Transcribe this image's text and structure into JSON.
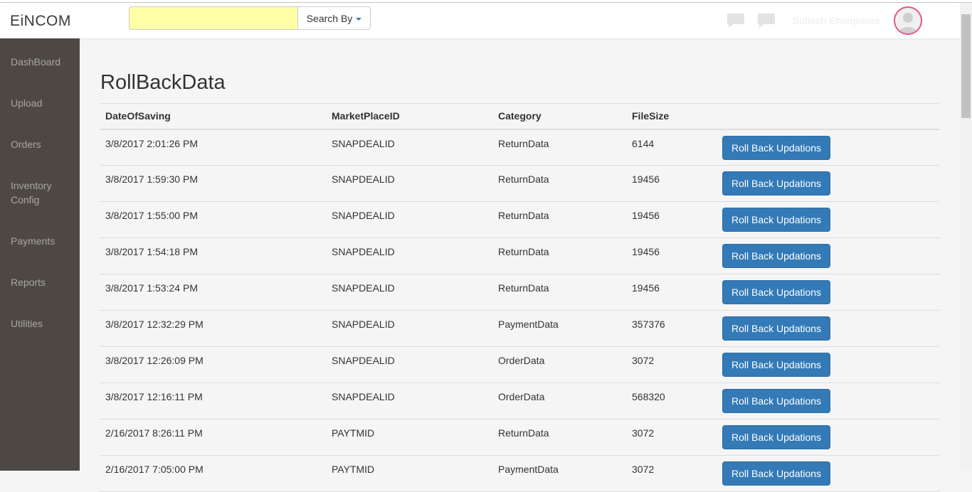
{
  "brand": {
    "logo": "EiNCOM"
  },
  "header": {
    "search": {
      "value": "",
      "placeholder": ""
    },
    "search_by_label": "Search By",
    "user_name": "Softech Enterprises"
  },
  "sidebar": {
    "items": [
      {
        "label": "DashBoard"
      },
      {
        "label": "Upload"
      },
      {
        "label": "Orders"
      },
      {
        "label": "Inventory Config"
      },
      {
        "label": "Payments"
      },
      {
        "label": "Reports"
      },
      {
        "label": "Utilities"
      }
    ]
  },
  "page": {
    "title": "RollBackData"
  },
  "table": {
    "columns": [
      "DateOfSaving",
      "MarketPlaceID",
      "Category",
      "FileSize",
      ""
    ],
    "rows": [
      {
        "date": "3/8/2017 2:01:26 PM",
        "marketplace": "SNAPDEALID",
        "category": "ReturnData",
        "size": "6144",
        "action": "Roll Back Updations"
      },
      {
        "date": "3/8/2017 1:59:30 PM",
        "marketplace": "SNAPDEALID",
        "category": "ReturnData",
        "size": "19456",
        "action": "Roll Back Updations"
      },
      {
        "date": "3/8/2017 1:55:00 PM",
        "marketplace": "SNAPDEALID",
        "category": "ReturnData",
        "size": "19456",
        "action": "Roll Back Updations"
      },
      {
        "date": "3/8/2017 1:54:18 PM",
        "marketplace": "SNAPDEALID",
        "category": "ReturnData",
        "size": "19456",
        "action": "Roll Back Updations"
      },
      {
        "date": "3/8/2017 1:53:24 PM",
        "marketplace": "SNAPDEALID",
        "category": "ReturnData",
        "size": "19456",
        "action": "Roll Back Updations"
      },
      {
        "date": "3/8/2017 12:32:29 PM",
        "marketplace": "SNAPDEALID",
        "category": "PaymentData",
        "size": "357376",
        "action": "Roll Back Updations"
      },
      {
        "date": "3/8/2017 12:26:09 PM",
        "marketplace": "SNAPDEALID",
        "category": "OrderData",
        "size": "3072",
        "action": "Roll Back Updations"
      },
      {
        "date": "3/8/2017 12:16:11 PM",
        "marketplace": "SNAPDEALID",
        "category": "OrderData",
        "size": "568320",
        "action": "Roll Back Updations"
      },
      {
        "date": "2/16/2017 8:26:11 PM",
        "marketplace": "PAYTMID",
        "category": "ReturnData",
        "size": "3072",
        "action": "Roll Back Updations"
      },
      {
        "date": "2/16/2017 7:05:00 PM",
        "marketplace": "PAYTMID",
        "category": "PaymentData",
        "size": "3072",
        "action": "Roll Back Updations"
      }
    ]
  },
  "colors": {
    "sidebar_bg": "#4d4844",
    "primary_button": "#337ab7",
    "search_bg": "#ffffa8",
    "avatar_ring": "#e0558f"
  },
  "icons": [
    "chat-icon",
    "messages-icon",
    "user-avatar-icon",
    "caret-down-icon"
  ]
}
